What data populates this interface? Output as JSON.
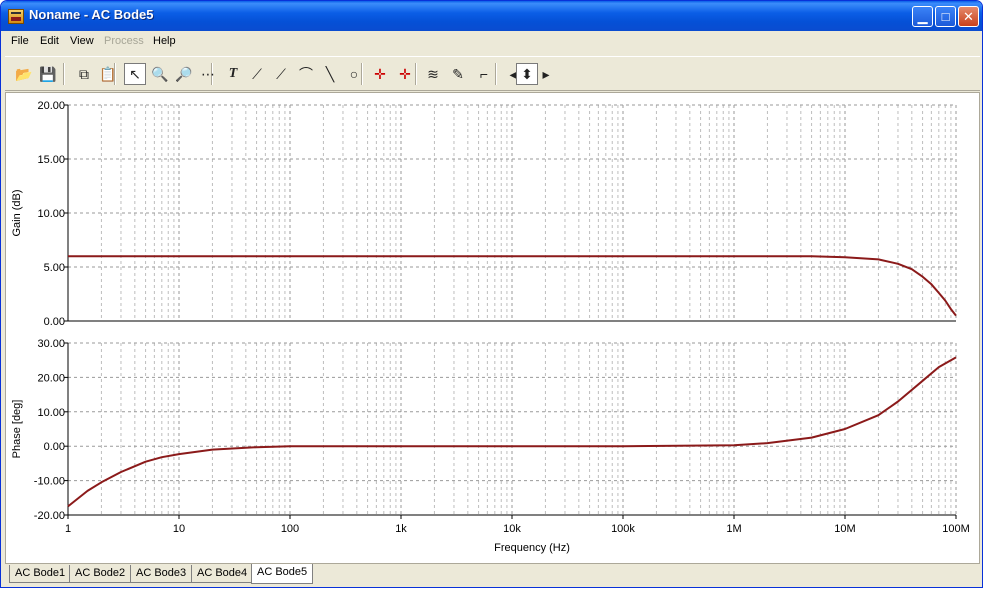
{
  "window": {
    "title": "Noname - AC Bode5"
  },
  "menu": [
    {
      "label": "File",
      "enabled": true
    },
    {
      "label": "Edit",
      "enabled": true
    },
    {
      "label": "View",
      "enabled": true
    },
    {
      "label": "Process",
      "enabled": false
    },
    {
      "label": "Help",
      "enabled": true
    }
  ],
  "toolbar": [
    {
      "name": "open-folder-icon",
      "glyph": "📂"
    },
    {
      "name": "save-icon",
      "glyph": "💾"
    },
    {
      "name": "copy-icon",
      "glyph": "⧉"
    },
    {
      "name": "paste-icon",
      "glyph": "📋"
    },
    {
      "name": "pointer-icon",
      "glyph": "↖",
      "pressed": true
    },
    {
      "name": "zoom-in-icon",
      "glyph": "🔍"
    },
    {
      "name": "zoom-100-icon",
      "glyph": "🔎"
    },
    {
      "name": "grid-icon",
      "glyph": "⋯"
    },
    {
      "name": "text-icon",
      "glyph": "T"
    },
    {
      "name": "label-curve-icon",
      "glyph": "⟋"
    },
    {
      "name": "label-curve2-icon",
      "glyph": "⟋"
    },
    {
      "name": "formula-label-icon",
      "glyph": "⌒"
    },
    {
      "name": "line-icon",
      "glyph": "╲"
    },
    {
      "name": "ellipse-icon",
      "glyph": "○"
    },
    {
      "name": "cursor-a-icon",
      "glyph": "✛"
    },
    {
      "name": "cursor-b-icon",
      "glyph": "✛"
    },
    {
      "name": "curves-icon",
      "glyph": "≋"
    },
    {
      "name": "marker-icon",
      "glyph": "✎"
    },
    {
      "name": "step-icon",
      "glyph": "⌐"
    },
    {
      "name": "arrow-left-icon",
      "glyph": "◂"
    },
    {
      "name": "arrow-updown-icon",
      "glyph": "⬍",
      "pressed": true
    },
    {
      "name": "arrow-right-icon",
      "glyph": "▸"
    }
  ],
  "tabs": [
    {
      "label": "AC Bode1",
      "active": false
    },
    {
      "label": "AC Bode2",
      "active": false
    },
    {
      "label": "AC Bode3",
      "active": false
    },
    {
      "label": "AC Bode4",
      "active": false
    },
    {
      "label": "AC Bode5",
      "active": true
    }
  ],
  "chart_data": [
    {
      "type": "line",
      "ylabel": "Gain (dB)",
      "xscale": "log",
      "xlim": [
        1,
        100000000
      ],
      "ylim": [
        0,
        20
      ],
      "yticks": [
        "0.00",
        "5.00",
        "10.00",
        "15.00",
        "20.00"
      ],
      "grid": true,
      "color": "#8b1a1a",
      "series": [
        {
          "x": [
            1,
            10,
            100,
            1000,
            10000,
            100000,
            1000000,
            5000000,
            10000000,
            20000000,
            30000000,
            40000000,
            50000000,
            60000000,
            70000000,
            80000000,
            90000000,
            100000000
          ],
          "y": [
            6.0,
            6.0,
            6.0,
            6.0,
            6.0,
            6.0,
            6.0,
            6.0,
            5.9,
            5.7,
            5.3,
            4.8,
            4.1,
            3.4,
            2.6,
            1.9,
            1.1,
            0.5
          ]
        }
      ]
    },
    {
      "type": "line",
      "ylabel": "Phase [deg]",
      "xlabel": "Frequency (Hz)",
      "xscale": "log",
      "xlim": [
        1,
        100000000
      ],
      "ylim": [
        -20,
        30
      ],
      "yticks": [
        "-20.00",
        "-10.00",
        "0.00",
        "10.00",
        "20.00",
        "30.00"
      ],
      "xticks": [
        "1",
        "10",
        "100",
        "1k",
        "10k",
        "100k",
        "1M",
        "10M",
        "100M"
      ],
      "grid": true,
      "color": "#8b1a1a",
      "series": [
        {
          "x": [
            1,
            1.5,
            2,
            3,
            5,
            7,
            10,
            20,
            50,
            100,
            1000,
            10000,
            100000,
            1000000,
            2000000,
            5000000,
            10000000,
            20000000,
            30000000,
            50000000,
            70000000,
            100000000
          ],
          "y": [
            -17.5,
            -13.0,
            -10.5,
            -7.5,
            -4.5,
            -3.2,
            -2.3,
            -1.0,
            -0.3,
            0.0,
            0.0,
            0.0,
            0.0,
            0.3,
            0.9,
            2.5,
            5.0,
            9.0,
            13.0,
            19.0,
            23.0,
            25.8
          ]
        }
      ]
    }
  ]
}
